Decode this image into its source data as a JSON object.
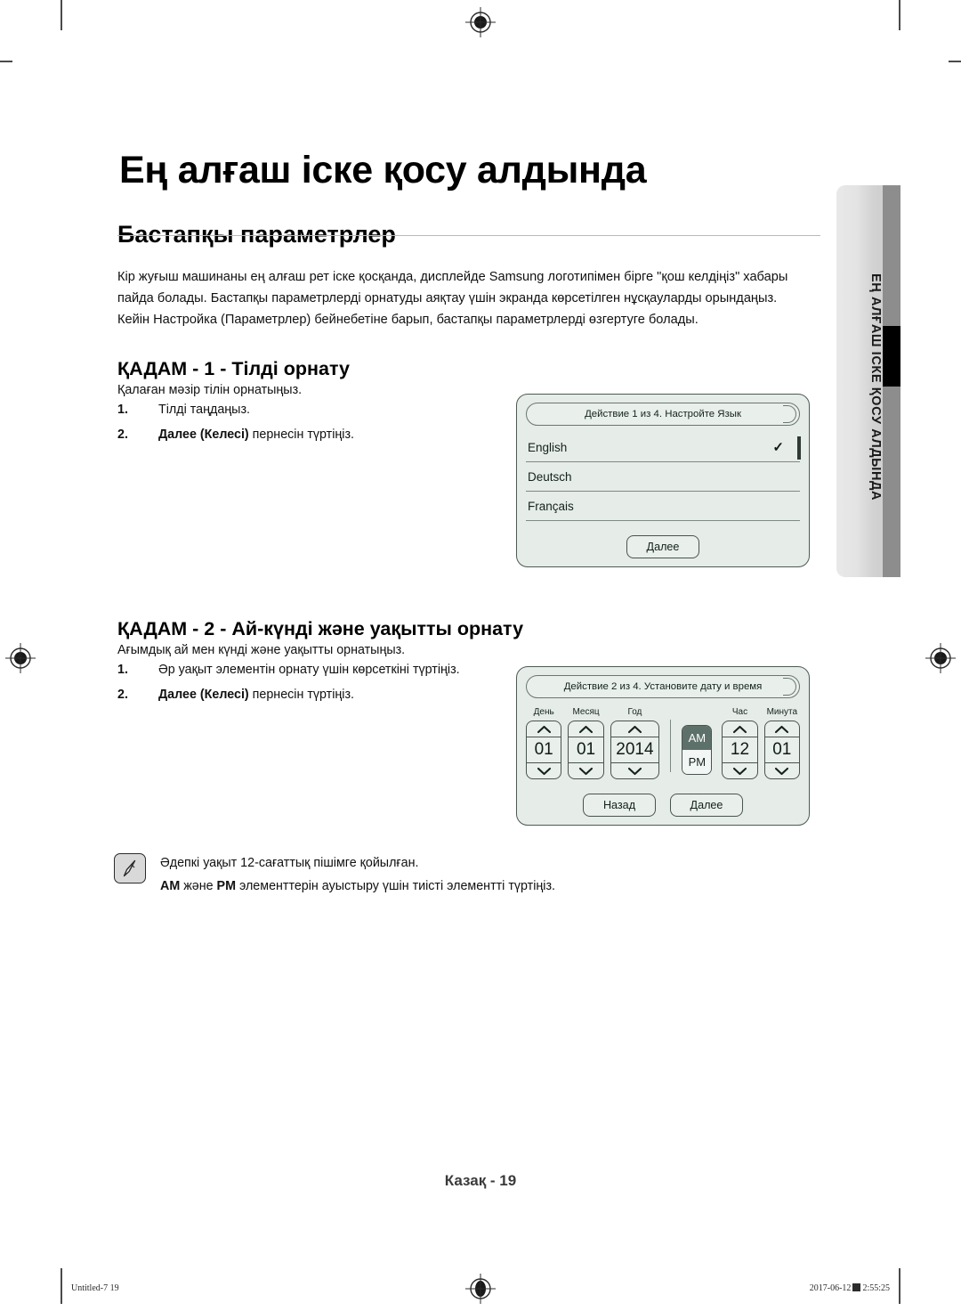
{
  "document": {
    "chapter_title": "Ең алғаш іске қосу алдында",
    "section_title": "Бастапқы параметрлер",
    "intro": "Кір жуғыш машинаны ең алғаш рет іске қосқанда, дисплейде Samsung логотипімен бірге \"қош келдіңіз\" хабары пайда болады. Бастапқы параметрлерді орнатуды аяқтау үшін экранда көрсетілген нұсқауларды орындаңыз. Кейін Настройка (Параметрлер) бейнебетіне барып, бастапқы параметрлерді өзгертуге болады.",
    "side_tab_label": "ЕҢ АЛҒАШ ІСКЕ ҚОСУ АЛДЫНДА",
    "page_number": "Казақ - 19"
  },
  "step1": {
    "heading": "ҚАДАМ - 1 - Тілді орнату",
    "lead": "Қалаған мәзір тілін орнатыңыз.",
    "items": [
      {
        "num": "1.",
        "bold": "",
        "rest": "Тілді таңдаңыз."
      },
      {
        "num": "2.",
        "bold": "Далее (Келесі)",
        "rest": " пернесін түртіңіз."
      }
    ]
  },
  "step2": {
    "heading": "ҚАДАМ - 2 - Ай-күнді және уақытты орнату",
    "lead": "Ағымдық ай мен күнді және уақытты орнатыңыз.",
    "items": [
      {
        "num": "1.",
        "bold": "",
        "rest": "Әр уақыт элементін орнату үшін көрсеткіні түртіңіз."
      },
      {
        "num": "2.",
        "bold": "Далее (Келесі)",
        "rest": " пернесін түртіңіз."
      }
    ]
  },
  "note": {
    "icon": "note-pen-icon",
    "line1": "Әдепкі уақыт 12-сағаттық пішімге қойылған.",
    "line2_bold_a": "AM",
    "line2_mid": " және ",
    "line2_bold_b": "PM",
    "line2_rest": " элементтерін ауыстыру үшін тиісті элементті түртіңіз."
  },
  "screen_language": {
    "title": "Действие 1 из 4. Настройте Язык",
    "options": [
      {
        "label": "English",
        "selected": "✓"
      },
      {
        "label": "Deutsch",
        "selected": ""
      },
      {
        "label": "Français",
        "selected": ""
      }
    ],
    "next_button": "Далее"
  },
  "screen_datetime": {
    "title": "Действие 2 из 4. Установите дату и время",
    "fields": [
      {
        "label": "День",
        "value": "01"
      },
      {
        "label": "Месяц",
        "value": "01"
      },
      {
        "label": "Год",
        "value": "2014"
      }
    ],
    "meridiem": {
      "am": "AM",
      "pm": "PM",
      "active": "AM"
    },
    "time_fields": [
      {
        "label": "Час",
        "value": "12"
      },
      {
        "label": "Минута",
        "value": "01"
      }
    ],
    "back_button": "Назад",
    "next_button": "Далее"
  },
  "print_slug": {
    "left": "Untitled-7   19",
    "right_date": "2017-06-12",
    "right_time": "2:55:25"
  },
  "colors": {
    "tab_strip": "#8d8d8d",
    "tab_marker": "#000000",
    "device_bg": "#e6ece8",
    "device_border": "#4e5a54",
    "ampm_active": "#5e706a"
  }
}
